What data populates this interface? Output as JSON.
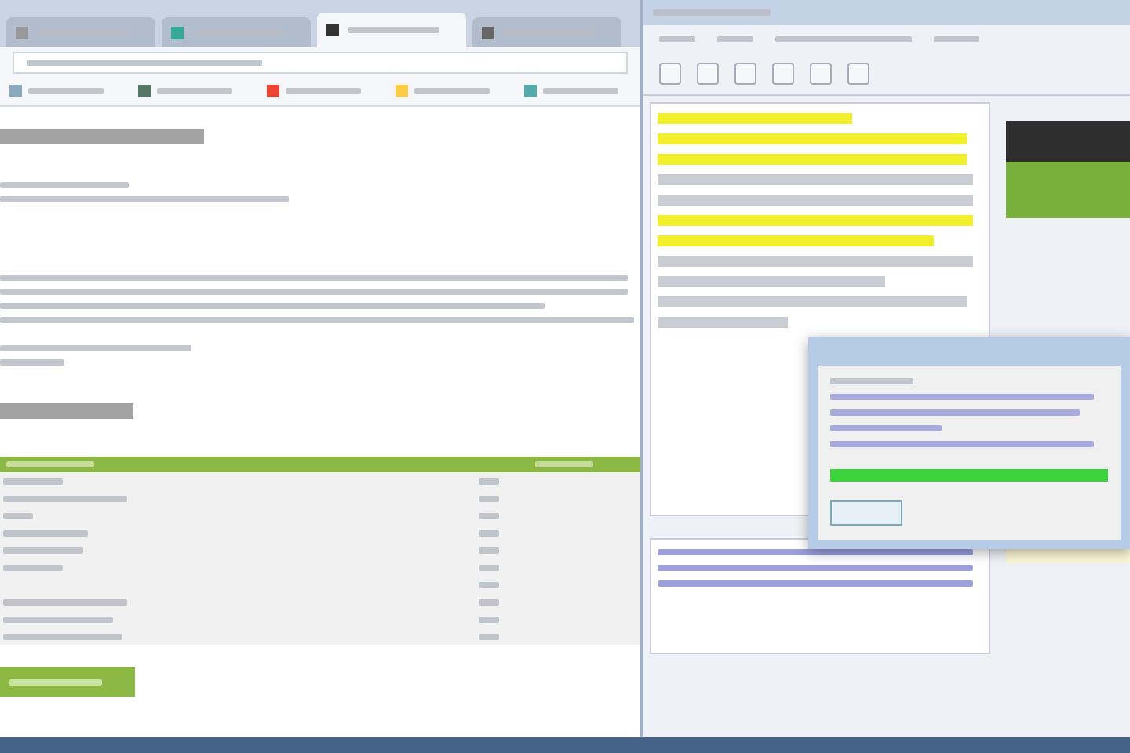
{
  "browser": {
    "tabs": [
      {
        "selected": false
      },
      {
        "selected": false
      },
      {
        "selected": true
      },
      {
        "selected": false
      }
    ]
  },
  "editor": {
    "lines": [
      {
        "highlighted": true
      },
      {
        "highlighted": true
      },
      {
        "highlighted": true
      },
      {
        "highlighted": false
      },
      {
        "highlighted": false
      },
      {
        "highlighted": true
      },
      {
        "highlighted": true
      },
      {
        "highlighted": false
      },
      {
        "highlighted": false
      },
      {
        "highlighted": false
      },
      {
        "highlighted": false
      }
    ]
  },
  "dialog": {
    "progress": {
      "level": 1
    }
  }
}
